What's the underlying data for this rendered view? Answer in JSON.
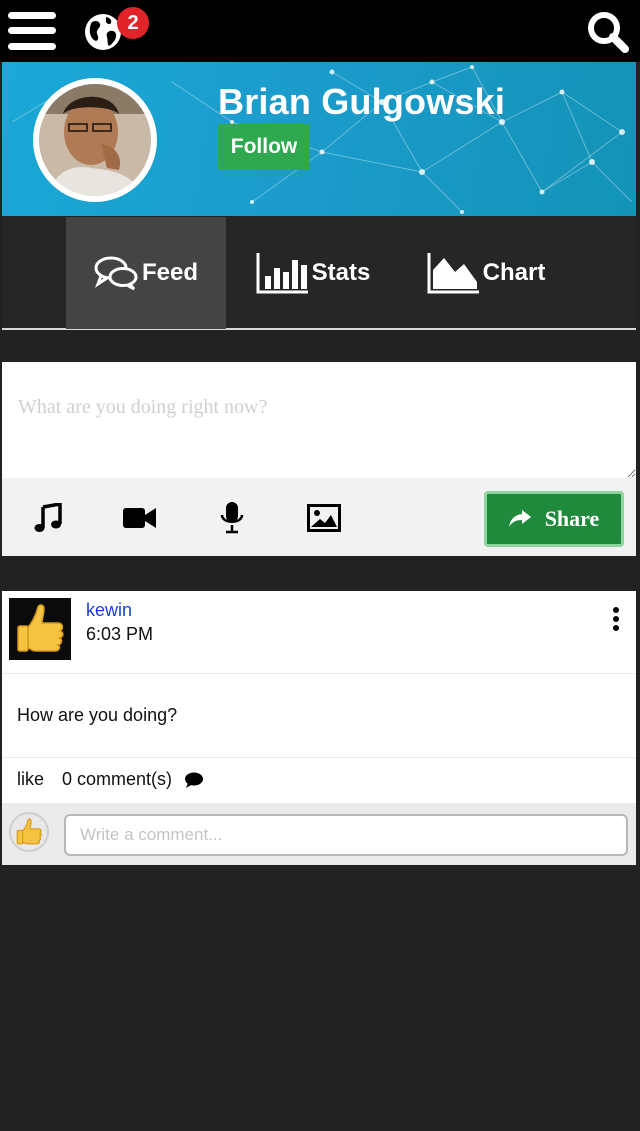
{
  "topbar": {
    "notification_count": "2",
    "icons": {
      "menu": "hamburger-menu-icon",
      "notifications": "globe-icon",
      "search": "search-icon"
    }
  },
  "profile": {
    "name": "Brian Gulgowski",
    "follow_label": "Follow",
    "header_color": "#1aa8d6"
  },
  "tabs": [
    {
      "label": "Feed",
      "icon": "speech-bubbles-icon",
      "active": true
    },
    {
      "label": "Stats",
      "icon": "bar-chart-icon",
      "active": false
    },
    {
      "label": "Chart",
      "icon": "area-chart-icon",
      "active": false
    }
  ],
  "composer": {
    "placeholder": "What are you doing right now?",
    "media_icons": [
      "music-note-icon",
      "video-camera-icon",
      "microphone-icon",
      "image-icon"
    ],
    "share_label": "Share",
    "share_color": "#1f8a3c"
  },
  "post": {
    "author": "kewin",
    "time": "6:03 PM",
    "body": "How are you doing?",
    "like_label": "like",
    "comments_label": "0 comment(s)",
    "comment_placeholder": "Write a comment..."
  }
}
